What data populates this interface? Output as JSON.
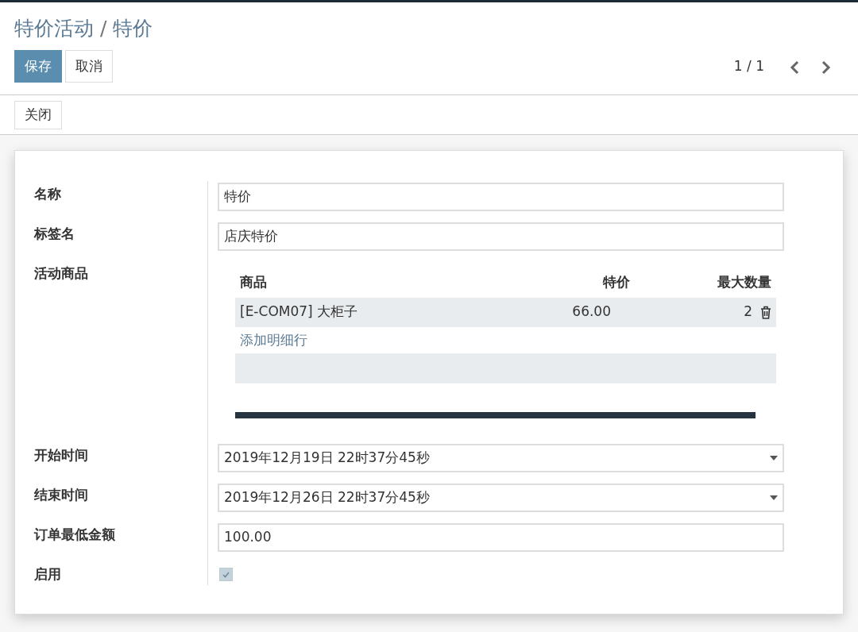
{
  "breadcrumb": {
    "parent": "特价活动",
    "separator": "/",
    "current": "特价"
  },
  "buttons": [
    {
      "label": "保存",
      "kind": "primary"
    },
    {
      "label": "取消",
      "kind": "secondary"
    }
  ],
  "pager": {
    "text": "1 / 1"
  },
  "close_button": {
    "label": "关闭"
  },
  "fields": [
    {
      "kind": "text",
      "label": "名称",
      "value": "特价"
    },
    {
      "kind": "text",
      "label": "标签名",
      "value": "店庆特价"
    },
    {
      "kind": "lines",
      "label": "活动商品",
      "columns": [
        "商品",
        "特价",
        "最大数量"
      ],
      "rows": [
        [
          "[E-COM07] 大柜子",
          "66.00",
          "2"
        ]
      ],
      "add_line": "添加明细行"
    },
    {
      "kind": "datetime",
      "label": "开始时间",
      "value": "2019年12月19日 22时37分45秒"
    },
    {
      "kind": "datetime",
      "label": "结束时间",
      "value": "2019年12月26日 22时37分45秒"
    },
    {
      "kind": "text",
      "label": "订单最低金额",
      "value": "100.00"
    },
    {
      "kind": "checkbox",
      "label": "启用",
      "checked": true
    }
  ]
}
